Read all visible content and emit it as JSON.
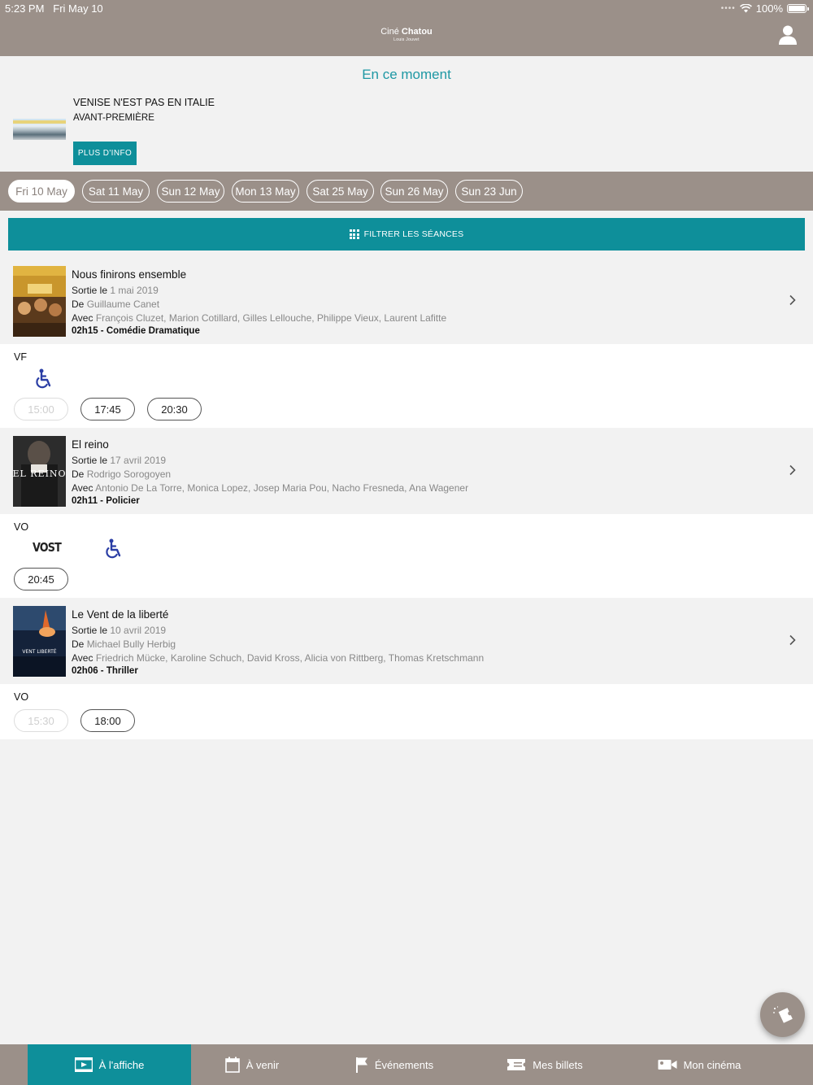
{
  "status": {
    "time": "5:23 PM",
    "date": "Fri May 10",
    "battery": "100%"
  },
  "header": {
    "logo_part1": "Ciné",
    "logo_part2": "Chatou",
    "logo_sub": "Louis Jouvet"
  },
  "current": {
    "heading": "En ce moment",
    "title": "VENISE N'EST PAS EN ITALIE",
    "subtitle": "AVANT-PREMIÈRE",
    "info_button": "PLUS D'INFO"
  },
  "dates": [
    "Fri 10 May",
    "Sat 11 May",
    "Sun 12 May",
    "Mon 13 May",
    "Sat 25 May",
    "Sun 26 May",
    "Sun 23 Jun"
  ],
  "filter_label": "FILTRER LES SÉANCES",
  "labels": {
    "release": "Sortie le",
    "director": "De",
    "cast": "Avec"
  },
  "films": [
    {
      "title": "Nous finirons ensemble",
      "release_date": "1 mai 2019",
      "director": "Guillaume Canet",
      "cast": "François Cluzet, Marion Cotillard, Gilles Lellouche, Philippe Vieux, Laurent Lafitte",
      "meta": "02h15 - Comédie Dramatique",
      "language": "VF",
      "times": [
        {
          "label": "15:00",
          "disabled": true
        },
        {
          "label": "17:45",
          "disabled": false
        },
        {
          "label": "20:30",
          "disabled": false
        }
      ]
    },
    {
      "title": "El reino",
      "release_date": "17 avril 2019",
      "director": "Rodrigo Sorogoyen",
      "cast": "Antonio De La Torre, Monica Lopez, Josep Maria Pou, Nacho Fresneda, Ana Wagener",
      "meta": "02h11 - Policier",
      "language": "VO",
      "badge": "VOST",
      "poster_text": "EL REINO",
      "times": [
        {
          "label": "20:45",
          "disabled": false
        }
      ]
    },
    {
      "title": "Le Vent de la liberté",
      "release_date": "10 avril 2019",
      "director": "Michael Bully Herbig",
      "cast": "Friedrich Mücke, Karoline Schuch, David Kross, Alicia von Rittberg, Thomas Kretschmann",
      "meta": "02h06 - Thriller",
      "language": "VO",
      "poster_text": "VENT LIBERTÉ",
      "times": [
        {
          "label": "15:30",
          "disabled": true
        },
        {
          "label": "18:00",
          "disabled": false
        }
      ]
    }
  ],
  "tabs": [
    "À l'affiche",
    "À venir",
    "Événements",
    "Mes billets",
    "Mon cinéma"
  ],
  "colors": {
    "brand": "#9b9089",
    "accent": "#0e8f9a",
    "title_accent": "#1f98a4"
  }
}
